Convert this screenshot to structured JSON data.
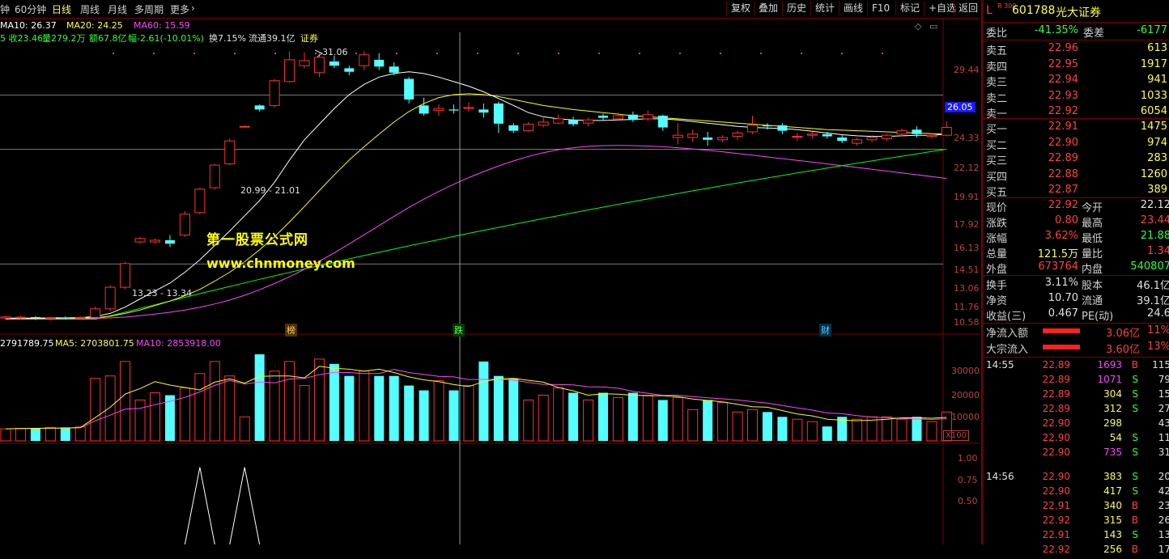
{
  "toolbar": {
    "periods": [
      "钟",
      "60分钟",
      "日线",
      "周线",
      "月线",
      "多周期",
      "更多"
    ],
    "active_period": "日线",
    "tools": [
      "复权",
      "叠加",
      "历史",
      "统计",
      "画线",
      "F10",
      "标记",
      "+自选",
      "返回"
    ]
  },
  "ma_line": {
    "ma10": "MA10: 26.37",
    "ma20": "MA20: 24.25",
    "ma60": "MA60: 15.59"
  },
  "stat_line": {
    "close": "5 收23.46",
    "vol": "量279.2万",
    "amount": "额67.8亿",
    "change": "幅-2.61(-10.01%)",
    "turnover": "换7.15%",
    "float": "流通39.1亿",
    "tag": "证券"
  },
  "price_axis": [
    "29.44",
    "26.05",
    "24.33",
    "22.12",
    "19.91",
    "17.92",
    "16.13",
    "14.51",
    "13.06",
    "11.76",
    "10.58"
  ],
  "annotations": {
    "high": "31.06",
    "range_upper": "20.99 - 21.01",
    "range_lower": "13.23 - 13.34"
  },
  "markers": [
    "榜",
    "跌",
    "财"
  ],
  "watermark": {
    "line1": "第一股票公式网",
    "line2": "www.chnmoney.com"
  },
  "volume_header": {
    "vol": "2791789.75",
    "ma5": "MA5: 2703801.75",
    "ma10": "MA10: 2853918.00"
  },
  "volume_axis": [
    "30000",
    "20000",
    "10000"
  ],
  "volume_unit": "X100",
  "indicator_axis": [
    "1.00",
    "0.75",
    "0.50"
  ],
  "colors": {
    "up": "#ff3030",
    "down": "#54ffff",
    "ma10": "#ffffff",
    "ma20": "#ffff00",
    "ma60": "#ff44ff",
    "ma_long": "#00ff00",
    "grid": "#800000"
  },
  "chart_data": {
    "type": "candlestick",
    "candles": [
      [
        10.7,
        10.75,
        10.6,
        10.8
      ],
      [
        10.72,
        10.74,
        10.65,
        10.78
      ],
      [
        10.74,
        10.7,
        10.62,
        10.79
      ],
      [
        10.7,
        10.72,
        10.6,
        10.76
      ],
      [
        10.72,
        10.7,
        10.64,
        10.77
      ],
      [
        10.7,
        10.73,
        10.62,
        10.78
      ],
      [
        10.73,
        11.1,
        10.7,
        11.2
      ],
      [
        11.1,
        12.1,
        11.0,
        12.2
      ],
      [
        12.1,
        13.3,
        12.0,
        13.4
      ],
      [
        14.5,
        14.7,
        14.4,
        14.8
      ],
      [
        14.5,
        14.6,
        14.4,
        14.7
      ],
      [
        14.6,
        14.4,
        14.2,
        14.9
      ],
      [
        14.9,
        16.2,
        14.8,
        16.4
      ],
      [
        16.3,
        17.9,
        16.2,
        18.0
      ],
      [
        18.0,
        19.7,
        17.9,
        19.8
      ],
      [
        19.8,
        21.7,
        19.7,
        21.9
      ],
      [
        23.0,
        23.0,
        22.9,
        23.1
      ],
      [
        25.0,
        24.6,
        24.4,
        25.1
      ],
      [
        25.0,
        27.6,
        24.8,
        27.8
      ],
      [
        27.5,
        30.0,
        27.4,
        31.0
      ],
      [
        29.3,
        29.9,
        29.0,
        30.9
      ],
      [
        28.5,
        30.3,
        28.0,
        30.8
      ],
      [
        29.8,
        29.3,
        29.0,
        30.5
      ],
      [
        29.0,
        28.6,
        28.2,
        29.3
      ],
      [
        29.3,
        30.6,
        28.8,
        31.06
      ],
      [
        30.0,
        29.2,
        28.8,
        30.8
      ],
      [
        29.2,
        28.5,
        28.2,
        29.7
      ],
      [
        27.8,
        25.6,
        25.2,
        28.0
      ],
      [
        25.0,
        24.2,
        24.0,
        25.8
      ],
      [
        24.5,
        24.7,
        24.0,
        25.1
      ],
      [
        24.6,
        24.5,
        24.2,
        25.1
      ],
      [
        24.7,
        24.8,
        24.4,
        25.3
      ],
      [
        24.6,
        24.3,
        23.8,
        25.2
      ],
      [
        25.2,
        23.25,
        22.4,
        25.4
      ],
      [
        23.1,
        22.6,
        22.4,
        23.3
      ],
      [
        22.6,
        23.2,
        22.5,
        23.4
      ],
      [
        23.1,
        23.4,
        22.9,
        23.8
      ],
      [
        23.3,
        23.7,
        23.2,
        24.1
      ],
      [
        23.6,
        23.2,
        23.0,
        23.9
      ],
      [
        23.3,
        23.6,
        23.0,
        23.8
      ],
      [
        24.0,
        23.8,
        23.5,
        24.2
      ],
      [
        23.7,
        24.0,
        23.6,
        24.3
      ],
      [
        24.1,
        23.6,
        23.4,
        24.4
      ],
      [
        23.7,
        24.1,
        23.5,
        24.5
      ],
      [
        24.0,
        22.9,
        22.6,
        24.1
      ],
      [
        22.0,
        22.2,
        21.4,
        23.3
      ],
      [
        22.0,
        22.3,
        21.6,
        22.7
      ],
      [
        22.0,
        21.8,
        21.3,
        22.5
      ],
      [
        21.8,
        22.0,
        21.6,
        22.2
      ],
      [
        22.1,
        22.4,
        21.8,
        22.6
      ],
      [
        22.5,
        23.1,
        22.3,
        24.0
      ],
      [
        23.1,
        23.0,
        22.7,
        23.3
      ],
      [
        23.1,
        22.6,
        22.3,
        23.3
      ],
      [
        22.1,
        22.1,
        21.7,
        22.4
      ],
      [
        22.2,
        22.3,
        21.9,
        22.5
      ],
      [
        22.3,
        22.1,
        21.9,
        22.5
      ],
      [
        22.0,
        21.7,
        21.5,
        22.2
      ],
      [
        21.5,
        21.8,
        21.3,
        22.0
      ],
      [
        21.8,
        22.0,
        21.6,
        22.2
      ],
      [
        21.9,
        22.2,
        21.7,
        22.3
      ],
      [
        22.3,
        22.6,
        22.1,
        22.8
      ],
      [
        22.7,
        22.3,
        22.0,
        23.0
      ],
      [
        22.1,
        22.2,
        21.9,
        22.4
      ],
      [
        22.2,
        22.9,
        22.1,
        23.44
      ]
    ],
    "volumes": [
      500,
      520,
      540,
      560,
      560,
      580,
      2600,
      2700,
      3300,
      1700,
      2000,
      1900,
      2200,
      2800,
      3300,
      2700,
      1000,
      3600,
      2900,
      3300,
      2300,
      3400,
      3200,
      2700,
      2900,
      2700,
      2700,
      2300,
      2100,
      2500,
      2100,
      2300,
      3300,
      2700,
      2600,
      1700,
      1900,
      2200,
      2000,
      1700,
      2000,
      1800,
      2000,
      1900,
      1700,
      1800,
      1300,
      1700,
      1600,
      1200,
      1300,
      1200,
      1000,
      900,
      800,
      600,
      1000,
      900,
      1000,
      1000,
      900,
      1000,
      800,
      1200
    ],
    "ma10": [
      10.7,
      10.7,
      10.7,
      10.71,
      10.71,
      10.72,
      10.77,
      10.9,
      11.18,
      11.55,
      11.92,
      12.3,
      12.85,
      13.5,
      14.3,
      15.15,
      16.1,
      17.1,
      18.4,
      20.1,
      21.8,
      23.2,
      24.7,
      26.1,
      27.2,
      28.0,
      28.4,
      28.6,
      28.4,
      28.0,
      27.5,
      27.0,
      26.4,
      25.7,
      25.0,
      24.3,
      23.9,
      23.7,
      23.6,
      23.55,
      23.55,
      23.6,
      23.65,
      23.7,
      23.7,
      23.6,
      23.45,
      23.3,
      23.15,
      23.0,
      22.9,
      22.85,
      22.8,
      22.7,
      22.55,
      22.4,
      22.25,
      22.15,
      22.1,
      22.1,
      22.15,
      22.2,
      22.2,
      22.3
    ],
    "ma20": [
      10.68,
      10.68,
      10.69,
      10.69,
      10.7,
      10.7,
      10.72,
      10.78,
      10.9,
      11.05,
      11.25,
      11.45,
      11.7,
      12.0,
      12.4,
      12.85,
      13.4,
      14.05,
      14.8,
      15.7,
      16.7,
      17.8,
      18.95,
      20.1,
      21.2,
      22.3,
      23.4,
      24.4,
      25.2,
      25.8,
      26.1,
      26.2,
      26.1,
      25.9,
      25.6,
      25.3,
      25.0,
      24.8,
      24.6,
      24.45,
      24.3,
      24.15,
      24.0,
      23.9,
      23.8,
      23.7,
      23.6,
      23.5,
      23.4,
      23.3,
      23.2,
      23.1,
      23.0,
      22.9,
      22.8,
      22.7,
      22.65,
      22.6,
      22.55,
      22.5,
      22.45,
      22.4,
      22.35,
      22.3
    ],
    "ma60": [
      10.65,
      10.66,
      10.66,
      10.67,
      10.67,
      10.68,
      10.69,
      10.71,
      10.74,
      10.8,
      10.87,
      10.95,
      11.05,
      11.17,
      11.32,
      11.5,
      11.72,
      11.98,
      12.28,
      12.62,
      13.0,
      13.42,
      13.88,
      14.38,
      14.92,
      15.48,
      16.06,
      16.64,
      17.2,
      17.74,
      18.25,
      18.74,
      19.2,
      19.64,
      20.04,
      20.4,
      20.7,
      20.95,
      21.12,
      21.24,
      21.3,
      21.32,
      21.3,
      21.26,
      21.2,
      21.12,
      21.02,
      20.9,
      20.78,
      20.64,
      20.5,
      20.36,
      20.22,
      20.08,
      19.94,
      19.8,
      19.66,
      19.52,
      19.38,
      19.24,
      19.1,
      18.96,
      18.82,
      18.68
    ],
    "ma_long_start": 10.65,
    "ma_long_end": 20.99,
    "indicator_peaks": [
      13,
      16
    ]
  },
  "quote": {
    "code_prefix": "L",
    "code_tag": "R 300",
    "code": "601788",
    "name": "光大证券",
    "weibi_label": "委比",
    "weibi": "-41.35%",
    "weicha_label": "委差",
    "weicha": "-6177",
    "asks": [
      {
        "label": "卖五",
        "price": "22.96",
        "vol": "613"
      },
      {
        "label": "卖四",
        "price": "22.95",
        "vol": "1917"
      },
      {
        "label": "卖三",
        "price": "22.94",
        "vol": "941"
      },
      {
        "label": "卖二",
        "price": "22.93",
        "vol": "1033"
      },
      {
        "label": "卖一",
        "price": "22.92",
        "vol": "6054"
      }
    ],
    "bids": [
      {
        "label": "买一",
        "price": "22.91",
        "vol": "1475"
      },
      {
        "label": "买二",
        "price": "22.90",
        "vol": "974"
      },
      {
        "label": "买三",
        "price": "22.89",
        "vol": "283"
      },
      {
        "label": "买四",
        "price": "22.88",
        "vol": "1260"
      },
      {
        "label": "买五",
        "price": "22.87",
        "vol": "389"
      }
    ],
    "stats": [
      {
        "l1": "现价",
        "v1": "22.92",
        "c1": "red",
        "l2": "今开",
        "v2": "22.12",
        "c2": "white"
      },
      {
        "l1": "涨跌",
        "v1": "0.80",
        "c1": "red",
        "l2": "最高",
        "v2": "23.44",
        "c2": "red"
      },
      {
        "l1": "涨幅",
        "v1": "3.62%",
        "c1": "red",
        "l2": "最低",
        "v2": "21.88",
        "c2": "green"
      },
      {
        "l1": "总量",
        "v1": "121.5万",
        "c1": "yellow",
        "l2": "量比",
        "v2": "1.34",
        "c2": "red"
      },
      {
        "l1": "外盘",
        "v1": "673764",
        "c1": "red",
        "l2": "内盘",
        "v2": "540807",
        "c2": "green"
      }
    ],
    "stats2": [
      {
        "l1": "换手",
        "v1": "3.11%",
        "l2": "股本",
        "v2": "46.1亿"
      },
      {
        "l1": "净资",
        "v1": "10.70",
        "l2": "流通",
        "v2": "39.1亿"
      },
      {
        "l1": "收益(三)",
        "v1": "0.467",
        "l2": "PE(动)",
        "v2": "24.6"
      }
    ],
    "flows": [
      {
        "label": "净流入额",
        "value": "3.06亿",
        "pct": "11%"
      },
      {
        "label": "大宗流入",
        "value": "3.60亿",
        "pct": "13%"
      }
    ],
    "ticks": [
      {
        "time": "14:55",
        "price": "22.89",
        "vol": "1693",
        "vcolor": "purple",
        "bs": "B",
        "n": "115"
      },
      {
        "time": "",
        "price": "22.89",
        "vol": "1071",
        "vcolor": "purple",
        "bs": "S",
        "n": "79"
      },
      {
        "time": "",
        "price": "22.89",
        "vol": "304",
        "vcolor": "yellow",
        "bs": "S",
        "n": "15"
      },
      {
        "time": "",
        "price": "22.89",
        "vol": "312",
        "vcolor": "yellow",
        "bs": "S",
        "n": "27"
      },
      {
        "time": "",
        "price": "22.90",
        "vol": "298",
        "vcolor": "yellow",
        "bs": "",
        "n": "43"
      },
      {
        "time": "",
        "price": "22.90",
        "vol": "54",
        "vcolor": "yellow",
        "bs": "S",
        "n": "11"
      },
      {
        "time": "",
        "price": "22.90",
        "vol": "735",
        "vcolor": "purple",
        "bs": "S",
        "n": "31"
      },
      {
        "time": "14:56",
        "price": "22.90",
        "vol": "383",
        "vcolor": "yellow",
        "bs": "S",
        "n": "20"
      },
      {
        "time": "",
        "price": "22.90",
        "vol": "417",
        "vcolor": "yellow",
        "bs": "S",
        "n": "42"
      },
      {
        "time": "",
        "price": "22.91",
        "vol": "340",
        "vcolor": "yellow",
        "bs": "B",
        "n": "23"
      },
      {
        "time": "",
        "price": "22.92",
        "vol": "315",
        "vcolor": "yellow",
        "bs": "B",
        "n": "26"
      },
      {
        "time": "",
        "price": "22.91",
        "vol": "143",
        "vcolor": "yellow",
        "bs": "S",
        "n": "13"
      },
      {
        "time": "",
        "price": "22.92",
        "vol": "256",
        "vcolor": "yellow",
        "bs": "B",
        "n": "17"
      }
    ]
  }
}
